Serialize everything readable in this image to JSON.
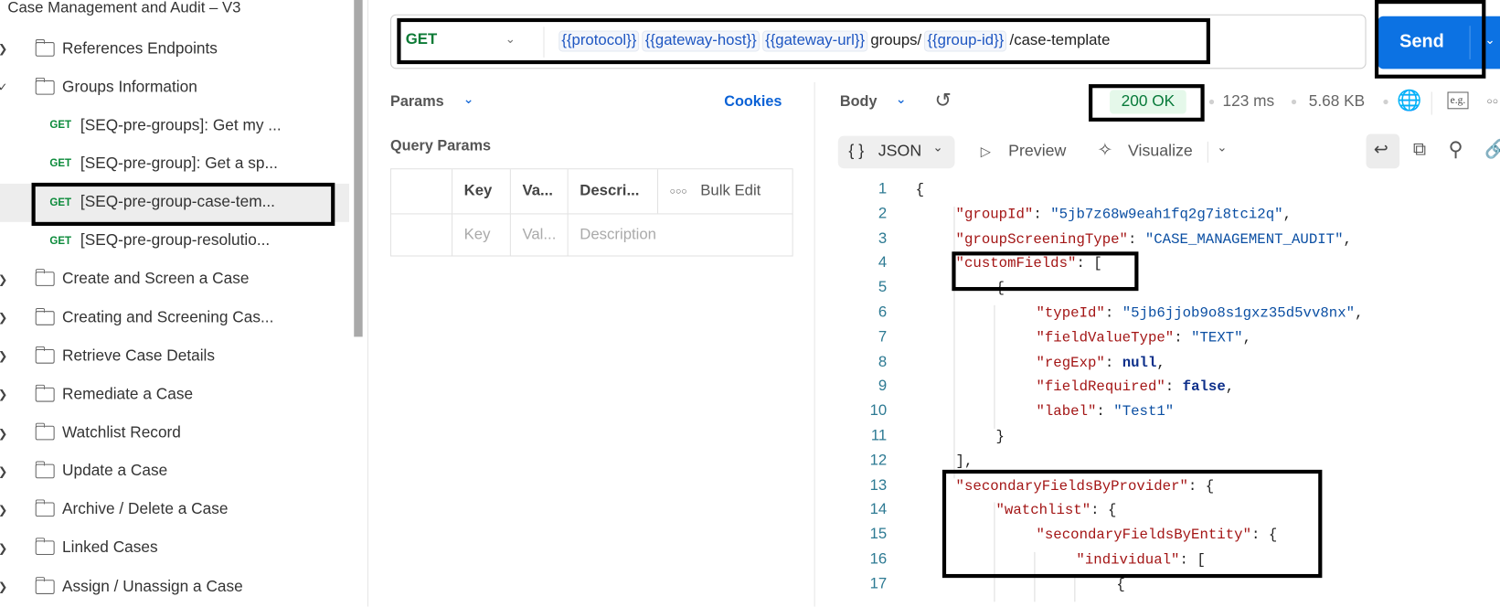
{
  "sidebar": {
    "collection_title": "Case Management and Audit – V3",
    "items": [
      {
        "type": "folder",
        "label": "References Endpoints",
        "expanded": false
      },
      {
        "type": "folder",
        "label": "Groups Information",
        "expanded": true
      },
      {
        "type": "request",
        "method": "GET",
        "label": "[SEQ-pre-groups]: Get my ..."
      },
      {
        "type": "request",
        "method": "GET",
        "label": "[SEQ-pre-group]: Get a sp..."
      },
      {
        "type": "request",
        "method": "GET",
        "label": "[SEQ-pre-group-case-tem...",
        "selected": true
      },
      {
        "type": "request",
        "method": "GET",
        "label": "[SEQ-pre-group-resolutio..."
      },
      {
        "type": "folder",
        "label": "Create and Screen a Case",
        "expanded": false
      },
      {
        "type": "folder",
        "label": "Creating and Screening Cas...",
        "expanded": false
      },
      {
        "type": "folder",
        "label": "Retrieve Case Details",
        "expanded": false
      },
      {
        "type": "folder",
        "label": "Remediate a Case",
        "expanded": false
      },
      {
        "type": "folder",
        "label": "Watchlist Record",
        "expanded": false
      },
      {
        "type": "folder",
        "label": "Update a Case",
        "expanded": false
      },
      {
        "type": "folder",
        "label": "Archive / Delete a Case",
        "expanded": false
      },
      {
        "type": "folder",
        "label": "Linked Cases",
        "expanded": false
      },
      {
        "type": "folder",
        "label": "Assign / Unassign a Case",
        "expanded": false
      }
    ]
  },
  "request": {
    "method": "GET",
    "url_parts": [
      {
        "kind": "var",
        "text": "{{protocol}}"
      },
      {
        "kind": "var",
        "text": "{{gateway-host}}"
      },
      {
        "kind": "var",
        "text": "{{gateway-url}}"
      },
      {
        "kind": "lit",
        "text": "groups/"
      },
      {
        "kind": "var",
        "text": "{{group-id}}"
      },
      {
        "kind": "lit",
        "text": "/case-template"
      }
    ],
    "send_label": "Send",
    "params_label": "Params",
    "cookies_label": "Cookies",
    "query_params_title": "Query Params",
    "table_headers": [
      "Key",
      "Va...",
      "Descri...",
      "Bulk Edit"
    ],
    "placeholders": [
      "Key",
      "Val...",
      "Description"
    ]
  },
  "response": {
    "body_label": "Body",
    "status": "200 OK",
    "time": "123 ms",
    "size": "5.68 KB",
    "example_label": "e.g.",
    "format_label": "JSON",
    "preview_label": "Preview",
    "visualize_label": "Visualize",
    "colors": {
      "status_bg": "#e5f8ea",
      "status_text": "#087a3a",
      "send": "#0c72e3"
    },
    "lines": [
      [
        [
          0,
          "p",
          "{"
        ]
      ],
      [
        [
          1,
          "k",
          "\"groupId\""
        ],
        [
          0,
          "p",
          ": "
        ],
        [
          0,
          "s",
          "\"5jb7z68w9eah1fq2g7i8tci2q\""
        ],
        [
          0,
          "p",
          ","
        ]
      ],
      [
        [
          1,
          "k",
          "\"groupScreeningType\""
        ],
        [
          0,
          "p",
          ": "
        ],
        [
          0,
          "s",
          "\"CASE_MANAGEMENT_AUDIT\""
        ],
        [
          0,
          "p",
          ","
        ]
      ],
      [
        [
          1,
          "k",
          "\"customFields\""
        ],
        [
          0,
          "p",
          ": ["
        ]
      ],
      [
        [
          2,
          "p",
          "{"
        ]
      ],
      [
        [
          3,
          "k",
          "\"typeId\""
        ],
        [
          0,
          "p",
          ": "
        ],
        [
          0,
          "s",
          "\"5jb6jjob9o8s1gxz35d5vv8nx\""
        ],
        [
          0,
          "p",
          ","
        ]
      ],
      [
        [
          3,
          "k",
          "\"fieldValueType\""
        ],
        [
          0,
          "p",
          ": "
        ],
        [
          0,
          "s",
          "\"TEXT\""
        ],
        [
          0,
          "p",
          ","
        ]
      ],
      [
        [
          3,
          "k",
          "\"regExp\""
        ],
        [
          0,
          "p",
          ": "
        ],
        [
          0,
          "b",
          "null"
        ],
        [
          0,
          "p",
          ","
        ]
      ],
      [
        [
          3,
          "k",
          "\"fieldRequired\""
        ],
        [
          0,
          "p",
          ": "
        ],
        [
          0,
          "b",
          "false"
        ],
        [
          0,
          "p",
          ","
        ]
      ],
      [
        [
          3,
          "k",
          "\"label\""
        ],
        [
          0,
          "p",
          ": "
        ],
        [
          0,
          "s",
          "\"Test1\""
        ]
      ],
      [
        [
          2,
          "p",
          "}"
        ]
      ],
      [
        [
          1,
          "p",
          "],"
        ]
      ],
      [
        [
          1,
          "k",
          "\"secondaryFieldsByProvider\""
        ],
        [
          0,
          "p",
          ": {"
        ]
      ],
      [
        [
          2,
          "k",
          "\"watchlist\""
        ],
        [
          0,
          "p",
          ": {"
        ]
      ],
      [
        [
          3,
          "k",
          "\"secondaryFieldsByEntity\""
        ],
        [
          0,
          "p",
          ": {"
        ]
      ],
      [
        [
          4,
          "k",
          "\"individual\""
        ],
        [
          0,
          "p",
          ": ["
        ]
      ],
      [
        [
          5,
          "p",
          "{"
        ]
      ]
    ]
  }
}
